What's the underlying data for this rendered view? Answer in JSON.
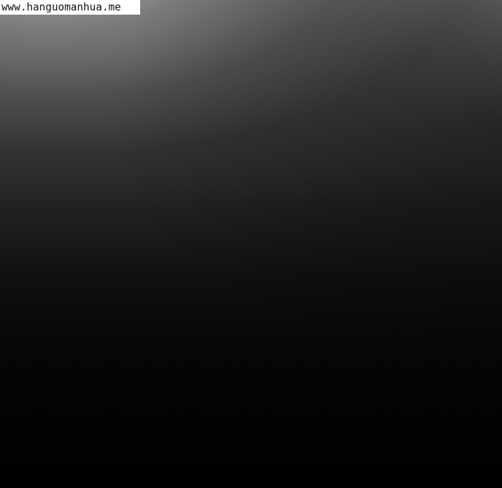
{
  "watermark": {
    "text": "www.hanguomanhua.me"
  }
}
